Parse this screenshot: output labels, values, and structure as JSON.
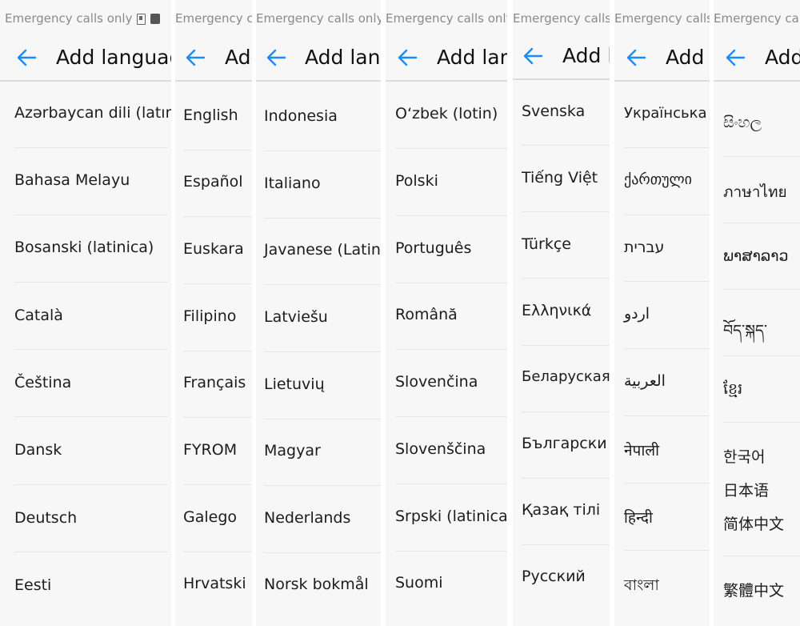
{
  "screens": [
    {
      "status_text": "Emergency calls only",
      "title": "Add language",
      "items": [
        "Azərbaycan dili (latın)",
        "Bahasa Melayu",
        "Bosanski (latinica)",
        "Català",
        "Čeština",
        "Dansk",
        "Deutsch",
        "Eesti"
      ]
    },
    {
      "status_text": "Emergency calls only",
      "title": "Add language",
      "items": [
        "English",
        "Español",
        "Euskara",
        "Filipino",
        "Français",
        "FYROM",
        "Galego",
        "Hrvatski"
      ]
    },
    {
      "status_text": "Emergency calls only",
      "title": "Add language",
      "items": [
        "Indonesia",
        "Italiano",
        "Javanese (Latin)",
        "Latviešu",
        "Lietuvių",
        "Magyar",
        "Nederlands",
        "Norsk bokmål"
      ]
    },
    {
      "status_text": "Emergency calls only",
      "title": "Add language",
      "items": [
        "O‘zbek (lotin)",
        "Polski",
        "Português",
        "Română",
        "Slovenčina",
        "Slovenščina",
        "Srpski (latinica)",
        "Suomi"
      ]
    },
    {
      "status_text": "Emergency calls only",
      "title": "Add language",
      "items": [
        "Svenska",
        "Tiếng Việt",
        "Türkçe",
        "Ελληνικά",
        "Беларуская",
        "Български",
        "Қазақ тілі",
        "Русский"
      ]
    },
    {
      "status_text": "Emergency calls only",
      "title": "Add language",
      "items": [
        "Українська",
        "ქართული",
        "עברית",
        "اردو",
        "العربية",
        "नेपाली",
        "हिन्दी",
        "বাংলা"
      ]
    },
    {
      "status_text": "Emergency calls only",
      "title": "Add language",
      "items": [
        "සිංහල",
        "ภาษาไทย",
        "ພາສາລາວ",
        "བོད་སྐད་",
        "ខ្មែរ",
        "한국어",
        "日本语",
        "简体中文",
        "繁體中文"
      ]
    }
  ],
  "colors": {
    "accent": "#1a8cff",
    "divider": "#e6e6e6",
    "text": "#1c1c1c"
  }
}
